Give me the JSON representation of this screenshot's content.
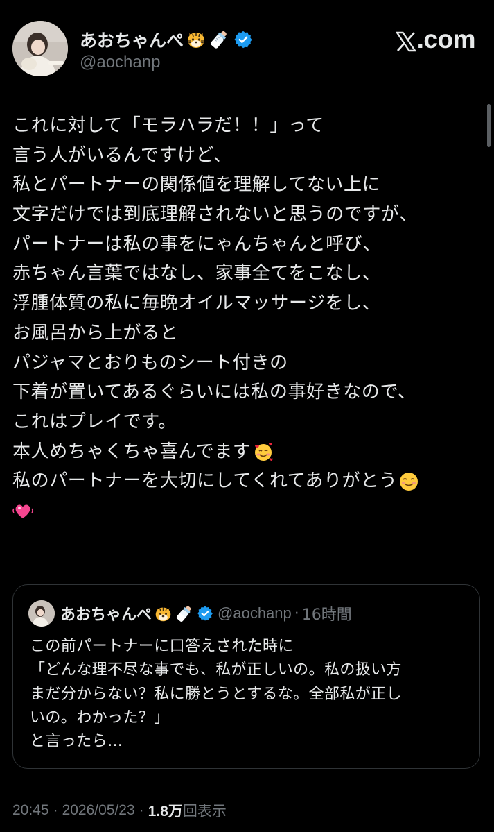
{
  "site": {
    "logo_text": ".com",
    "logo_icon": "x-logo-icon"
  },
  "author": {
    "display_name": "あおちゃんぺ",
    "name_emojis": [
      "tiger-face-emoji",
      "baby-bottle-emoji"
    ],
    "verified_badge": "verified-badge-icon",
    "handle": "@aochanp"
  },
  "tweet": {
    "lines": [
      "これに対して「モラハラだ！！」って",
      "言う人がいるんですけど、",
      "私とパートナーの関係値を理解してない上に",
      "文字だけでは到底理解されないと思うのですが、",
      "パートナーは私の事をにゃんちゃんと呼び、",
      "赤ちゃん言葉ではなし、家事全てをこなし、",
      "浮腫体質の私に毎晩オイルマッサージをし、",
      "お風呂から上がると",
      "パジャマとおりものシート付きの",
      "下着が置いてあるぐらいには私の事好きなので、",
      "これはプレイです。",
      "本人めちゃくちゃ喜んでます",
      "私のパートナーを大切にしてくれてありがとう"
    ],
    "line_emojis": {
      "line_12": "smiling-face-with-hearts-emoji",
      "line_13": "smiling-face-emoji",
      "line_14": "beating-heart-emoji"
    }
  },
  "quote": {
    "display_name": "あおちゃんぺ",
    "handle": "@aochanp",
    "separator": "·",
    "time": "16時間",
    "lines": [
      "この前パートナーに口答えされた時に",
      "「どんな理不尽な事でも、私が正しいの。私の扱い方",
      "まだ分からない？私に勝とうとするな。全部私が正し",
      "いの。わかった？」",
      "と言ったら…"
    ]
  },
  "meta": {
    "time": "20:45",
    "separator": "·",
    "date": "2026/05/23",
    "views_count": "1.8万",
    "views_label": "回表示"
  },
  "colors": {
    "background": "#000000",
    "text_primary": "#e7e9ea",
    "text_secondary": "#71767b",
    "border": "#2f3336",
    "verified_blue": "#1d9bf0"
  }
}
